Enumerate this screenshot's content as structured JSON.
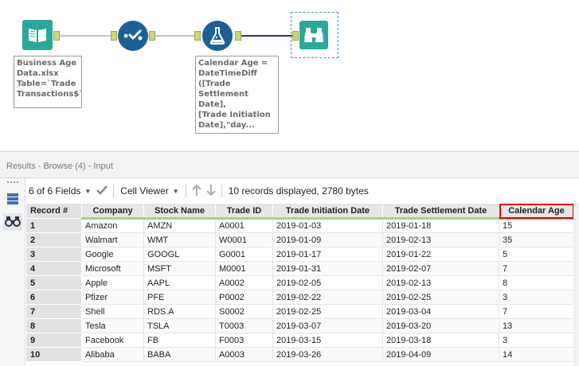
{
  "workflow": {
    "input_annotation": "Business Age\nData.xlsx\nTable=`Trade\nTransactions$`",
    "formula_annotation": "Calendar Age =\nDateTimeDiff\n([Trade\nSettlement Date],\n[Trade Initiation\nDate],\"day..."
  },
  "results": {
    "title": "Results - Browse (4) - Input",
    "fields_label": "6 of 6 Fields",
    "cell_viewer_label": "Cell Viewer",
    "records_info": "10 records displayed, 2780 bytes",
    "highlight_color": "#e00000",
    "accent_color": "#a8d08d",
    "columns": [
      "Record #",
      "Company",
      "Stock Name",
      "Trade ID",
      "Trade Initiation Date",
      "Trade Settlement Date",
      "Calendar Age"
    ],
    "rows": [
      [
        "1",
        "Amazon",
        "AMZN",
        "A0001",
        "2019-01-03",
        "2019-01-18",
        "15"
      ],
      [
        "2",
        "Walmart",
        "WMT",
        "W0001",
        "2019-01-09",
        "2019-02-13",
        "35"
      ],
      [
        "3",
        "Google",
        "GOOGL",
        "G0001",
        "2019-01-17",
        "2019-01-22",
        "5"
      ],
      [
        "4",
        "Microsoft",
        "MSFT",
        "M0001",
        "2019-01-31",
        "2019-02-07",
        "7"
      ],
      [
        "5",
        "Apple",
        "AAPL",
        "A0002",
        "2019-02-05",
        "2019-02-13",
        "8"
      ],
      [
        "6",
        "Pfizer",
        "PFE",
        "P0002",
        "2019-02-22",
        "2019-02-25",
        "3"
      ],
      [
        "7",
        "Shell",
        "RDS.A",
        "S0002",
        "2019-02-25",
        "2019-03-04",
        "7"
      ],
      [
        "8",
        "Tesla",
        "TSLA",
        "T0003",
        "2019-03-07",
        "2019-03-20",
        "13"
      ],
      [
        "9",
        "Facebook",
        "FB",
        "F0003",
        "2019-03-15",
        "2019-03-18",
        "3"
      ],
      [
        "10",
        "Alibaba",
        "BABA",
        "A0003",
        "2019-03-26",
        "2019-04-09",
        "14"
      ]
    ]
  },
  "icons": {
    "input_tool": "book-icon",
    "select_tool": "checkmark-icon",
    "formula_tool": "flask-icon",
    "browse_tool": "binoculars-icon",
    "fields_check": "check-icon",
    "sort_up": "arrow-up-icon",
    "sort_down": "arrow-down-icon",
    "side_table": "table-view-icon",
    "side_browse": "binoculars-icon"
  }
}
